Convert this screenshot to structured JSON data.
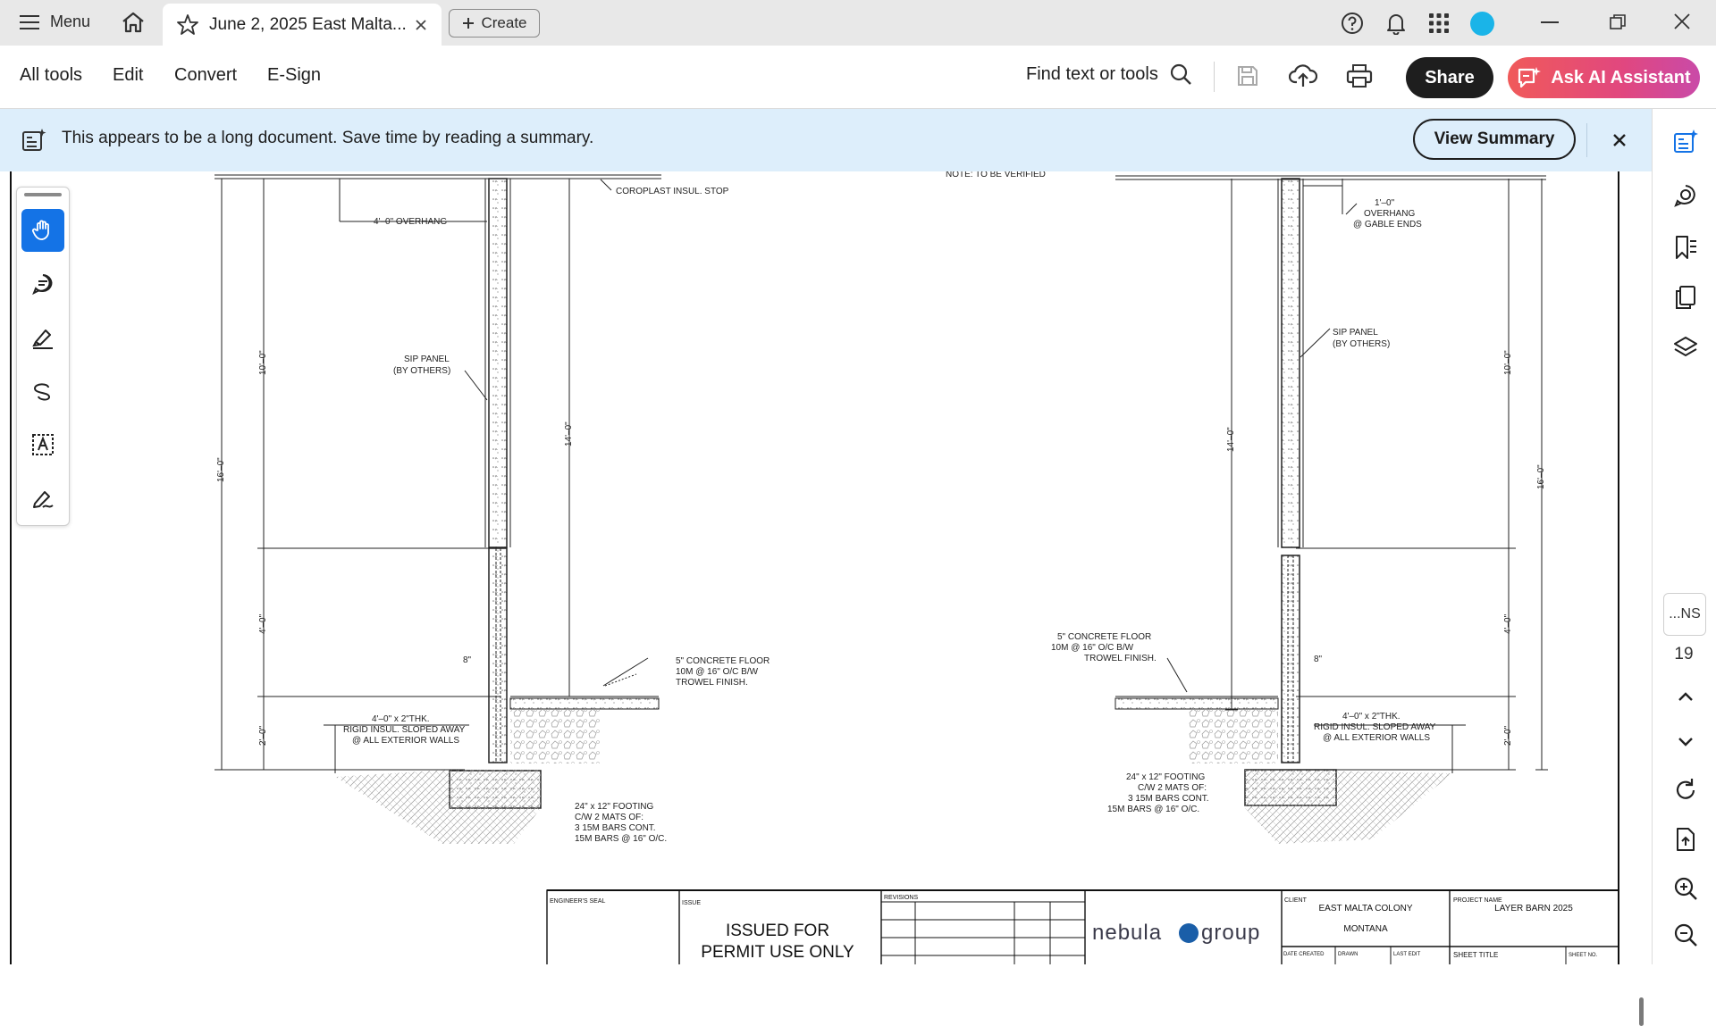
{
  "titlebar": {
    "menu_label": "Menu",
    "tab_title": "June 2, 2025 East Malta...",
    "create_label": "Create"
  },
  "toolbar": {
    "all_tools": "All tools",
    "edit": "Edit",
    "convert": "Convert",
    "esign": "E-Sign",
    "find_label": "Find text or tools",
    "share_label": "Share",
    "ai_label": "Ask AI Assistant"
  },
  "banner": {
    "message": "This appears to be a long document. Save time by reading a summary.",
    "button_label": "View Summary"
  },
  "rail": {
    "page_box_label": "...NS",
    "page_number": "19"
  },
  "colors": {
    "accent_blue": "#1473e6",
    "banner_bg": "#ddeefb",
    "ai_gradient_start": "#f05a5a",
    "ai_gradient_end": "#c94aa8",
    "avatar": "#1ab4e8"
  },
  "drawing": {
    "note_top": "NOTE: TO BE VERIFIED",
    "coroplast": "COROPLAST INSUL. STOP",
    "overhang_left": "4'–0\" OVERHANG",
    "overhang_right_1": "1'–0\"",
    "overhang_right_2": "OVERHANG",
    "overhang_right_3": "@ GABLE ENDS",
    "sip_1": "SIP PANEL",
    "sip_2": "(BY OTHERS)",
    "floor_1": "5\" CONCRETE FLOOR",
    "floor_2": "10M @ 16\" O/C B/W",
    "floor_3": "TROWEL FINISH.",
    "insul_1": "4'–0\" x 2\"THK.",
    "insul_2": "RIGID INSUL. SLOPED AWAY",
    "insul_3": "@ ALL EXTERIOR WALLS",
    "footing_1": "24\" x 12\" FOOTING",
    "footing_2": "C/W 2 MATS OF:",
    "footing_3": "3 15M BARS CONT.",
    "footing_4": "15M BARS @ 16\" O/C.",
    "dim_16": "16'–0\"",
    "dim_10": "10'–0\"",
    "dim_14": "14'–0\"",
    "dim_4": "4'–0\"",
    "dim_2": "2'–0\"",
    "dim_8": "8\""
  },
  "title_block": {
    "engineers_seal": "ENGINEER'S SEAL",
    "issue": "ISSUE",
    "issued_1": "ISSUED FOR",
    "issued_2": "PERMIT USE ONLY",
    "revisions": "REVISIONS",
    "logo_left": "nebula",
    "logo_right": "group",
    "client_label": "CLIENT",
    "client_1": "EAST MALTA COLONY",
    "client_2": "MONTANA",
    "project_label": "PROJECT NAME",
    "project_name": "LAYER BARN 2025",
    "date_created": "DATE CREATED",
    "drawn": "DRAWN",
    "last_edit": "LAST EDIT",
    "sheet_title": "SHEET TITLE",
    "sheet_no": "SHEET NO."
  }
}
